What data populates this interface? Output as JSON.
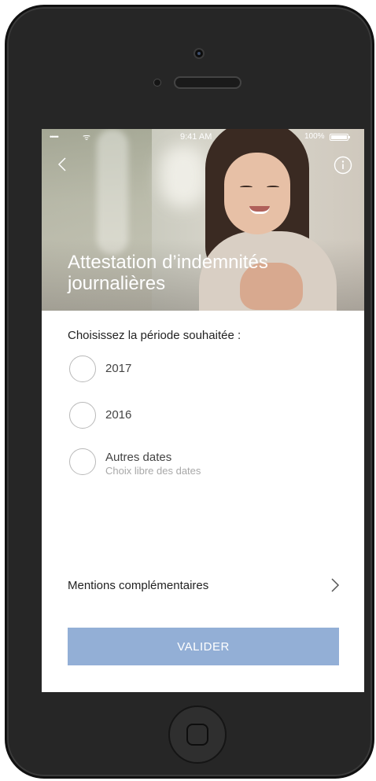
{
  "status_bar": {
    "signal": "•••••",
    "wifi": "ᯤ",
    "time": "9:41 AM",
    "battery_percent": "100%"
  },
  "header": {
    "back_icon": "chevron-left-icon",
    "info_icon": "info-icon",
    "title_line1": "Attestation d’indemnités",
    "title_line2": "journalières"
  },
  "main": {
    "section_title": "Choisissez la période souhaitée :",
    "options": [
      {
        "label": "2017",
        "sublabel": ""
      },
      {
        "label": "2016",
        "sublabel": ""
      },
      {
        "label": "Autres dates",
        "sublabel": "Choix libre des dates"
      }
    ],
    "mentions_label": "Mentions complémentaires",
    "validate_label": "VALIDER"
  },
  "colors": {
    "accent_button": "#93afd6",
    "text_dark": "#222222",
    "text_muted": "#a8a8a8",
    "phone_body": "#262626"
  }
}
